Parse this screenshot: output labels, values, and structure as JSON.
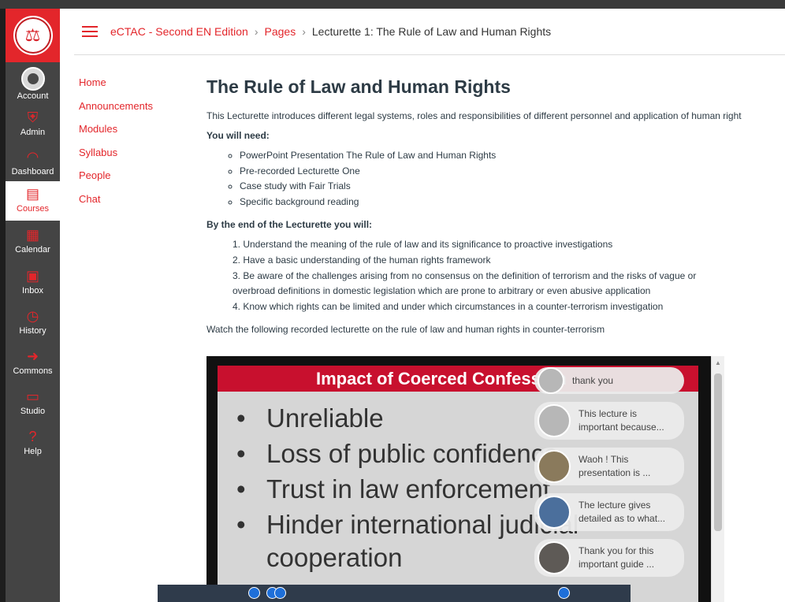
{
  "global_nav": {
    "items": [
      {
        "label": "Account",
        "icon": "account-avatar"
      },
      {
        "label": "Admin",
        "icon": "shield-icon"
      },
      {
        "label": "Dashboard",
        "icon": "speedometer-icon"
      },
      {
        "label": "Courses",
        "icon": "book-icon"
      },
      {
        "label": "Calendar",
        "icon": "calendar-icon"
      },
      {
        "label": "Inbox",
        "icon": "inbox-icon"
      },
      {
        "label": "History",
        "icon": "clock-icon"
      },
      {
        "label": "Commons",
        "icon": "commons-icon"
      },
      {
        "label": "Studio",
        "icon": "monitor-icon"
      },
      {
        "label": "Help",
        "icon": "question-icon"
      }
    ],
    "active": "Courses"
  },
  "breadcrumbs": [
    "eCTAC - Second EN Edition",
    "Pages",
    "Lecturette 1: The Rule of Law and Human Rights"
  ],
  "course_nav": [
    "Home",
    "Announcements",
    "Modules",
    "Syllabus",
    "People",
    "Chat"
  ],
  "page": {
    "title": "The Rule of Law and Human Rights",
    "intro": "This Lecturette introduces different legal systems, roles and responsibilities of different personnel and application of human right",
    "need_heading": "You will need:",
    "need_items": [
      "PowerPoint Presentation The Rule of Law and Human Rights",
      "Pre-recorded Lecturette One",
      "Case study with Fair Trials",
      "Specific background reading"
    ],
    "outcomes_heading": "By the end of the Lecturette you will:",
    "outcomes": [
      "1. Understand the meaning of the rule of law and its significance to proactive investigations",
      "2. Have a basic understanding of the human rights framework",
      "3. Be aware of the challenges arising from no consensus on the definition of terrorism and the risks of vague or",
      "overbroad definitions in domestic legislation which are prone to arbitrary or even abusive application",
      "4. Know which rights can be limited and under which circumstances in a counter-terrorism investigation"
    ],
    "watch_text": "Watch the following recorded lecturette on the rule of law and human rights in counter-terrorism"
  },
  "video": {
    "slide_title": "Impact of Coerced Confession",
    "bullets": [
      "Unreliable",
      "Loss of public confidence",
      "Trust in law enforcement",
      "Hinder international judicial"
    ],
    "bullet_continuation": "cooperation",
    "chat_messages": [
      {
        "line1": "thank you",
        "line2": ""
      },
      {
        "line1": "This lecture is",
        "line2": "important because..."
      },
      {
        "line1": "Waoh ! This",
        "line2": "presentation is     ..."
      },
      {
        "line1": "The lecture gives",
        "line2": "detailed as to what..."
      },
      {
        "line1": "Thank you for this",
        "line2": "important guide     ..."
      }
    ]
  },
  "colors": {
    "accent": "#e3262b",
    "nav_bg": "#444444",
    "slide_header": "#c8102e"
  }
}
